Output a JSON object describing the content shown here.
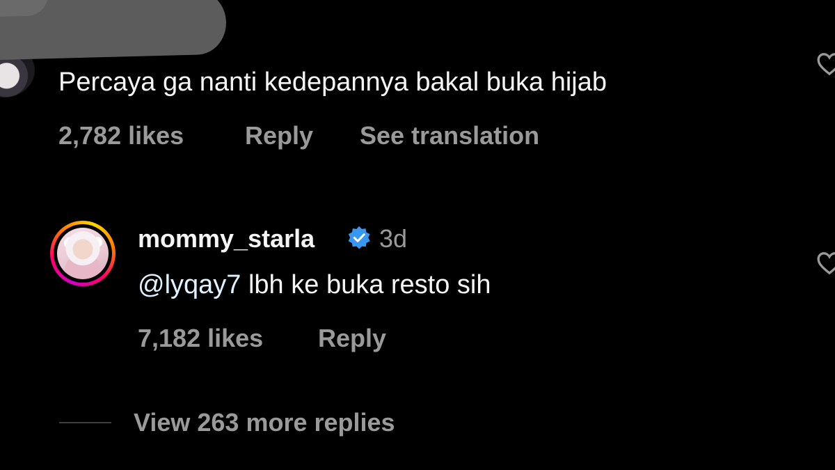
{
  "colors": {
    "background": "#000000",
    "text_primary": "#f5f5f5",
    "text_secondary": "#9a9a9a",
    "verified_blue": "#3897f0"
  },
  "comment1": {
    "text": "Percaya ga nanti kedepannya bakal buka hijab",
    "likes": "2,782 likes",
    "reply_label": "Reply",
    "translate_label": "See translation",
    "heart_icon": "heart-outline-icon"
  },
  "comment2": {
    "username": "mommy_starla",
    "verified_icon": "verified-badge-icon",
    "time": "3d",
    "mention": "@lyqay7",
    "text": " lbh ke buka resto sih",
    "likes": "7,182 likes",
    "reply_label": "Reply",
    "heart_icon": "heart-outline-icon"
  },
  "view_replies": {
    "label": "View 263 more replies"
  }
}
